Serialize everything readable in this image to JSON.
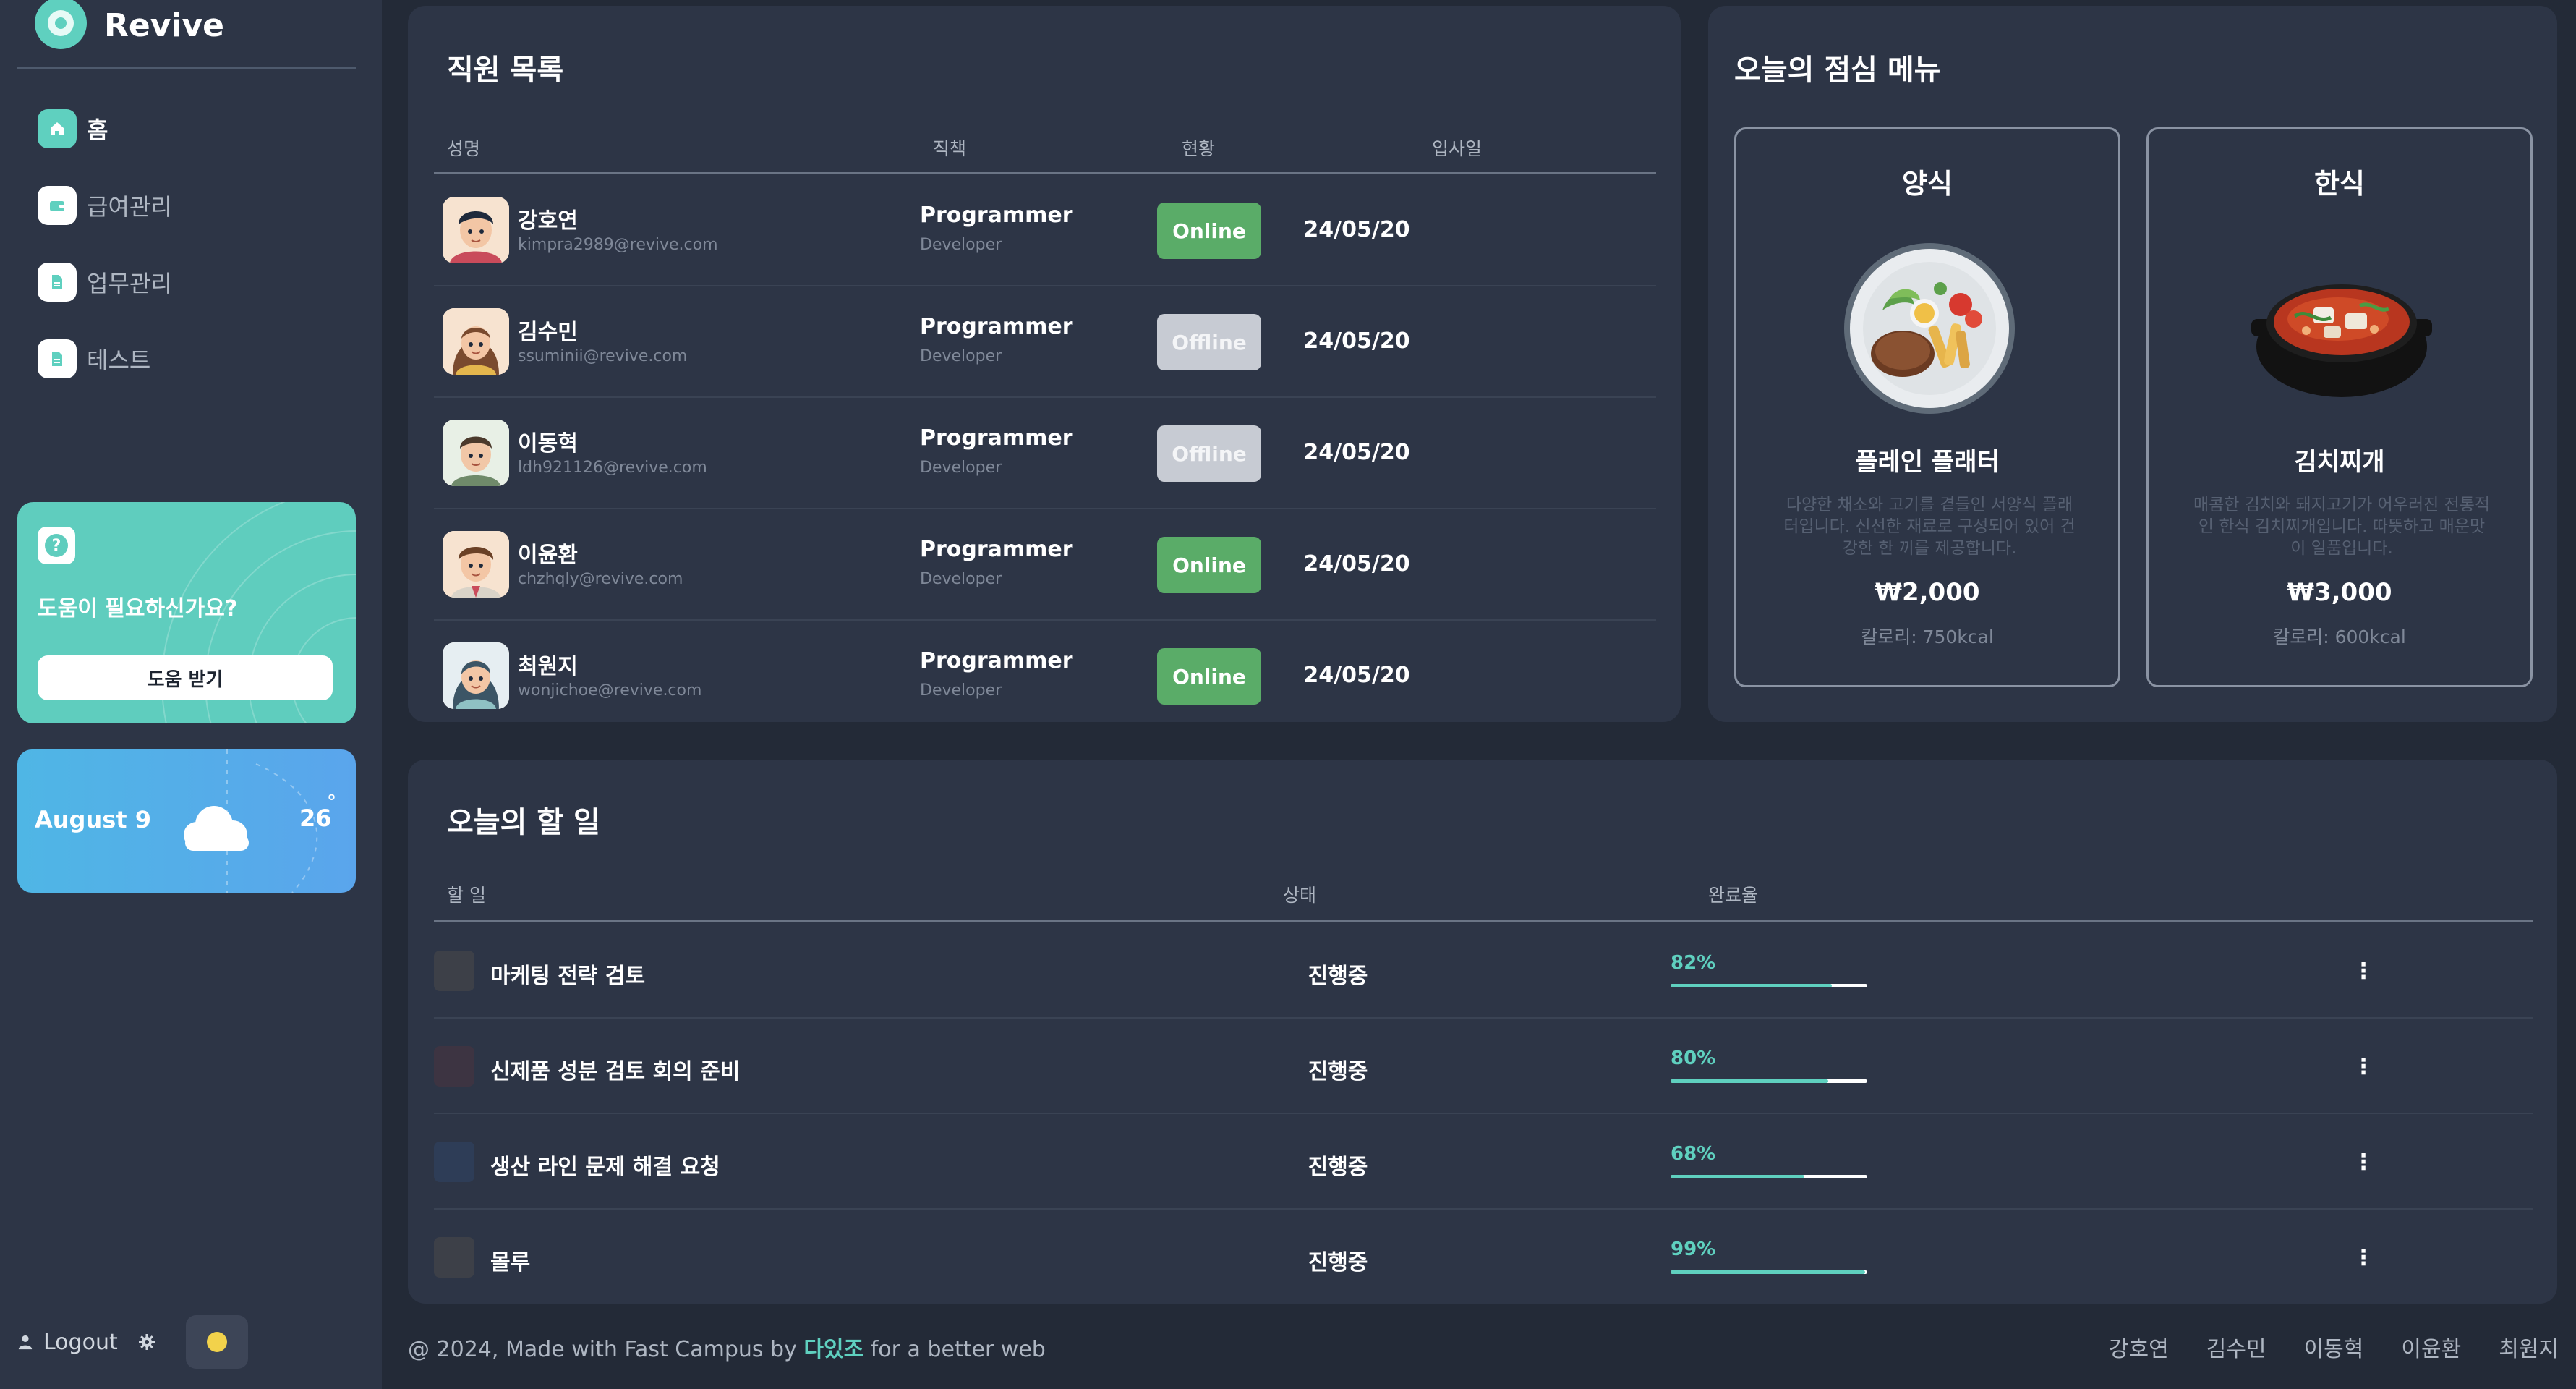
{
  "app": {
    "brand": "Revive"
  },
  "sidebar": {
    "items": [
      {
        "label": "홈",
        "icon": "home-icon",
        "active": true
      },
      {
        "label": "급여관리",
        "icon": "wallet-icon",
        "active": false
      },
      {
        "label": "업무관리",
        "icon": "document-icon",
        "active": false
      },
      {
        "label": "테스트",
        "icon": "document-icon",
        "active": false
      }
    ],
    "help": {
      "title": "도움이 필요하신가요?",
      "button": "도움 받기",
      "icon": "question-icon"
    },
    "weather": {
      "date": "August 9",
      "temp": "26",
      "degree": "°",
      "icon": "cloud-icon"
    },
    "logout": "Logout"
  },
  "employees": {
    "title": "직원 목록",
    "headers": [
      "성명",
      "직책",
      "현황",
      "입사일"
    ],
    "rows": [
      {
        "name": "강호연",
        "email": "kimpra2989@revive.com",
        "role": "Programmer",
        "sub": "Developer",
        "status": "Online",
        "date": "24/05/20"
      },
      {
        "name": "김수민",
        "email": "ssuminii@revive.com",
        "role": "Programmer",
        "sub": "Developer",
        "status": "Offline",
        "date": "24/05/20"
      },
      {
        "name": "이동혁",
        "email": "ldh921126@revive.com",
        "role": "Programmer",
        "sub": "Developer",
        "status": "Offline",
        "date": "24/05/20"
      },
      {
        "name": "이윤환",
        "email": "chzhqly@revive.com",
        "role": "Programmer",
        "sub": "Developer",
        "status": "Online",
        "date": "24/05/20"
      },
      {
        "name": "최원지",
        "email": "wonjichoe@revive.com",
        "role": "Programmer",
        "sub": "Developer",
        "status": "Online",
        "date": "24/05/20"
      }
    ]
  },
  "menu": {
    "title": "오늘의 점심 메뉴",
    "items": [
      {
        "category": "양식",
        "name": "플레인 플래터",
        "desc": "다양한 채소와 고기를 곁들인 서양식 플래터입니다. 신선한 재료로 구성되어 있어 건강한 한 끼를 제공합니다.",
        "price": "₩2,000",
        "calories": "칼로리: 750kcal"
      },
      {
        "category": "한식",
        "name": "김치찌개",
        "desc": "매콤한 김치와 돼지고기가 어우러진 전통적인 한식 김치찌개입니다. 따뜻하고 매운맛이 일품입니다.",
        "price": "₩3,000",
        "calories": "칼로리: 600kcal"
      }
    ]
  },
  "tasks": {
    "title": "오늘의 할 일",
    "headers": [
      "할 일",
      "상태",
      "완료율"
    ],
    "rows": [
      {
        "name": "마케팅 전략 검토",
        "status": "진행중",
        "progress": 82,
        "progress_label": "82%",
        "color": "#3d4048"
      },
      {
        "name": "신제품 성분 검토 회의 준비",
        "status": "진행중",
        "progress": 80,
        "progress_label": "80%",
        "color": "#3d3442"
      },
      {
        "name": "생산 라인 문제 해결 요청",
        "status": "진행중",
        "progress": 68,
        "progress_label": "68%",
        "color": "#2e3d57"
      },
      {
        "name": "몰루",
        "status": "진행중",
        "progress": 99,
        "progress_label": "99%",
        "color": "#3d4048"
      }
    ],
    "more_icon": "more-vertical-icon"
  },
  "footer": {
    "prefix": "@ 2024, Made with Fast Campus by",
    "team": "다있조",
    "suffix": "for a better web",
    "links": [
      "강호연",
      "김수민",
      "이동혁",
      "이윤환",
      "최원지"
    ]
  },
  "colors": {
    "accent": "#5fd0bf",
    "online": "#5aac68",
    "offline": "#c7cbd3",
    "background": "#232a37",
    "card": "#2d3546"
  }
}
